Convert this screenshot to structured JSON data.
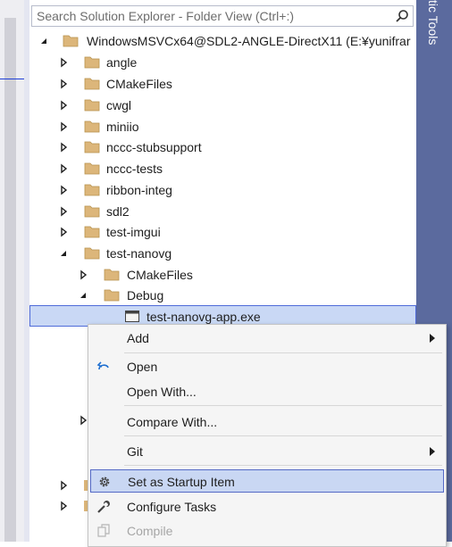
{
  "dock": {
    "label": "tic Tools"
  },
  "search": {
    "placeholder": "Search Solution Explorer - Folder View (Ctrl+:)"
  },
  "tree": {
    "root": "WindowsMSVCx64@SDL2-ANGLE-DirectX11 (E:¥yunifrar",
    "folders": [
      "angle",
      "CMakeFiles",
      "cwgl",
      "miniio",
      "nccc-stubsupport",
      "nccc-tests",
      "ribbon-integ",
      "sdl2",
      "test-imgui",
      "test-nanovg"
    ],
    "nanovg_children": [
      "CMakeFiles",
      "Debug"
    ],
    "selected_file": "test-nanovg-app.exe"
  },
  "context_menu": {
    "add": "Add",
    "open": "Open",
    "open_with": "Open With...",
    "compare_with": "Compare With...",
    "git": "Git",
    "set_startup": "Set as Startup Item",
    "configure_tasks": "Configure Tasks",
    "compile": "Compile"
  },
  "colors": {
    "folder": "#dcb67a",
    "dock": "#5b6a9e",
    "selection": "#c9d8f5",
    "menu_highlight": "#c9d7f3"
  }
}
